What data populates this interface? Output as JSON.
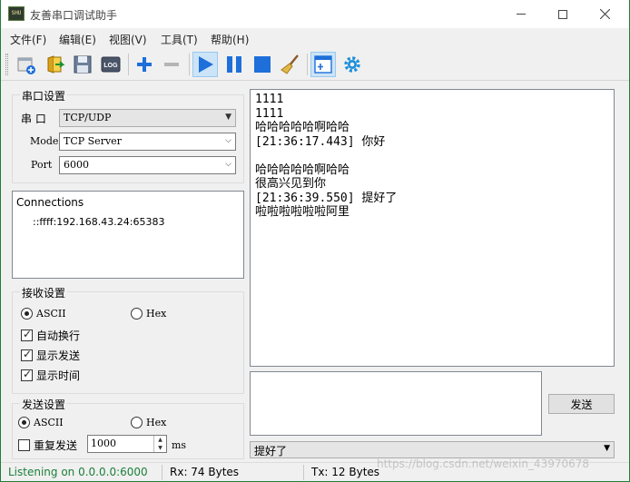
{
  "window": {
    "title": "友善串口调试助手",
    "icon_text": "SHU"
  },
  "menu": [
    "文件(F)",
    "编辑(E)",
    "视图(V)",
    "工具(T)",
    "帮助(H)"
  ],
  "toolbar": {
    "log_label": "LOG",
    "buttons": [
      "new-window",
      "open",
      "save",
      "log",
      "add",
      "remove",
      "run",
      "pause",
      "stop",
      "clear",
      "window-layout",
      "settings"
    ],
    "active": [
      "run",
      "window-layout"
    ]
  },
  "serial": {
    "group_title": "串口设置",
    "port_label": "串  口",
    "port_value": "TCP/UDP",
    "mode_label": "Mode",
    "mode_value": "TCP Server",
    "port_num_label": "Port",
    "port_num_value": "6000"
  },
  "connections": {
    "title": "Connections",
    "items": [
      "::ffff:192.168.43.24:65383"
    ]
  },
  "receive": {
    "group_title": "接收设置",
    "ascii_label": "ASCII",
    "hex_label": "Hex",
    "ascii_selected": true,
    "auto_wrap_label": "自动换行",
    "auto_wrap": true,
    "show_send_label": "显示发送",
    "show_send": true,
    "show_time_label": "显示时间",
    "show_time": true
  },
  "send": {
    "group_title": "发送设置",
    "ascii_label": "ASCII",
    "hex_label": "Hex",
    "ascii_selected": true,
    "repeat_label": "重复发送",
    "repeat": false,
    "interval_value": "1000",
    "interval_unit": "ms",
    "send_button": "发送",
    "input_value": "",
    "history_value": "提好了"
  },
  "rx_lines": [
    "1111",
    "1111",
    "哈哈哈哈哈啊哈哈",
    "[21:36:17.443] 你好",
    "",
    "哈哈哈哈哈啊哈哈",
    "很高兴见到你",
    "[21:36:39.550] 提好了",
    "啦啦啦啦啦啦阿里"
  ],
  "status": {
    "listening": "Listening on 0.0.0.0:6000",
    "rx": "Rx: 74 Bytes",
    "tx": "Tx: 12 Bytes",
    "watermark": "https://blog.csdn.net/weixin_43970678"
  },
  "colors": {
    "listening_text": "#1a7f3a",
    "toolbar_blue": "#1e6fd9",
    "window_border": "#1e7f3a"
  }
}
